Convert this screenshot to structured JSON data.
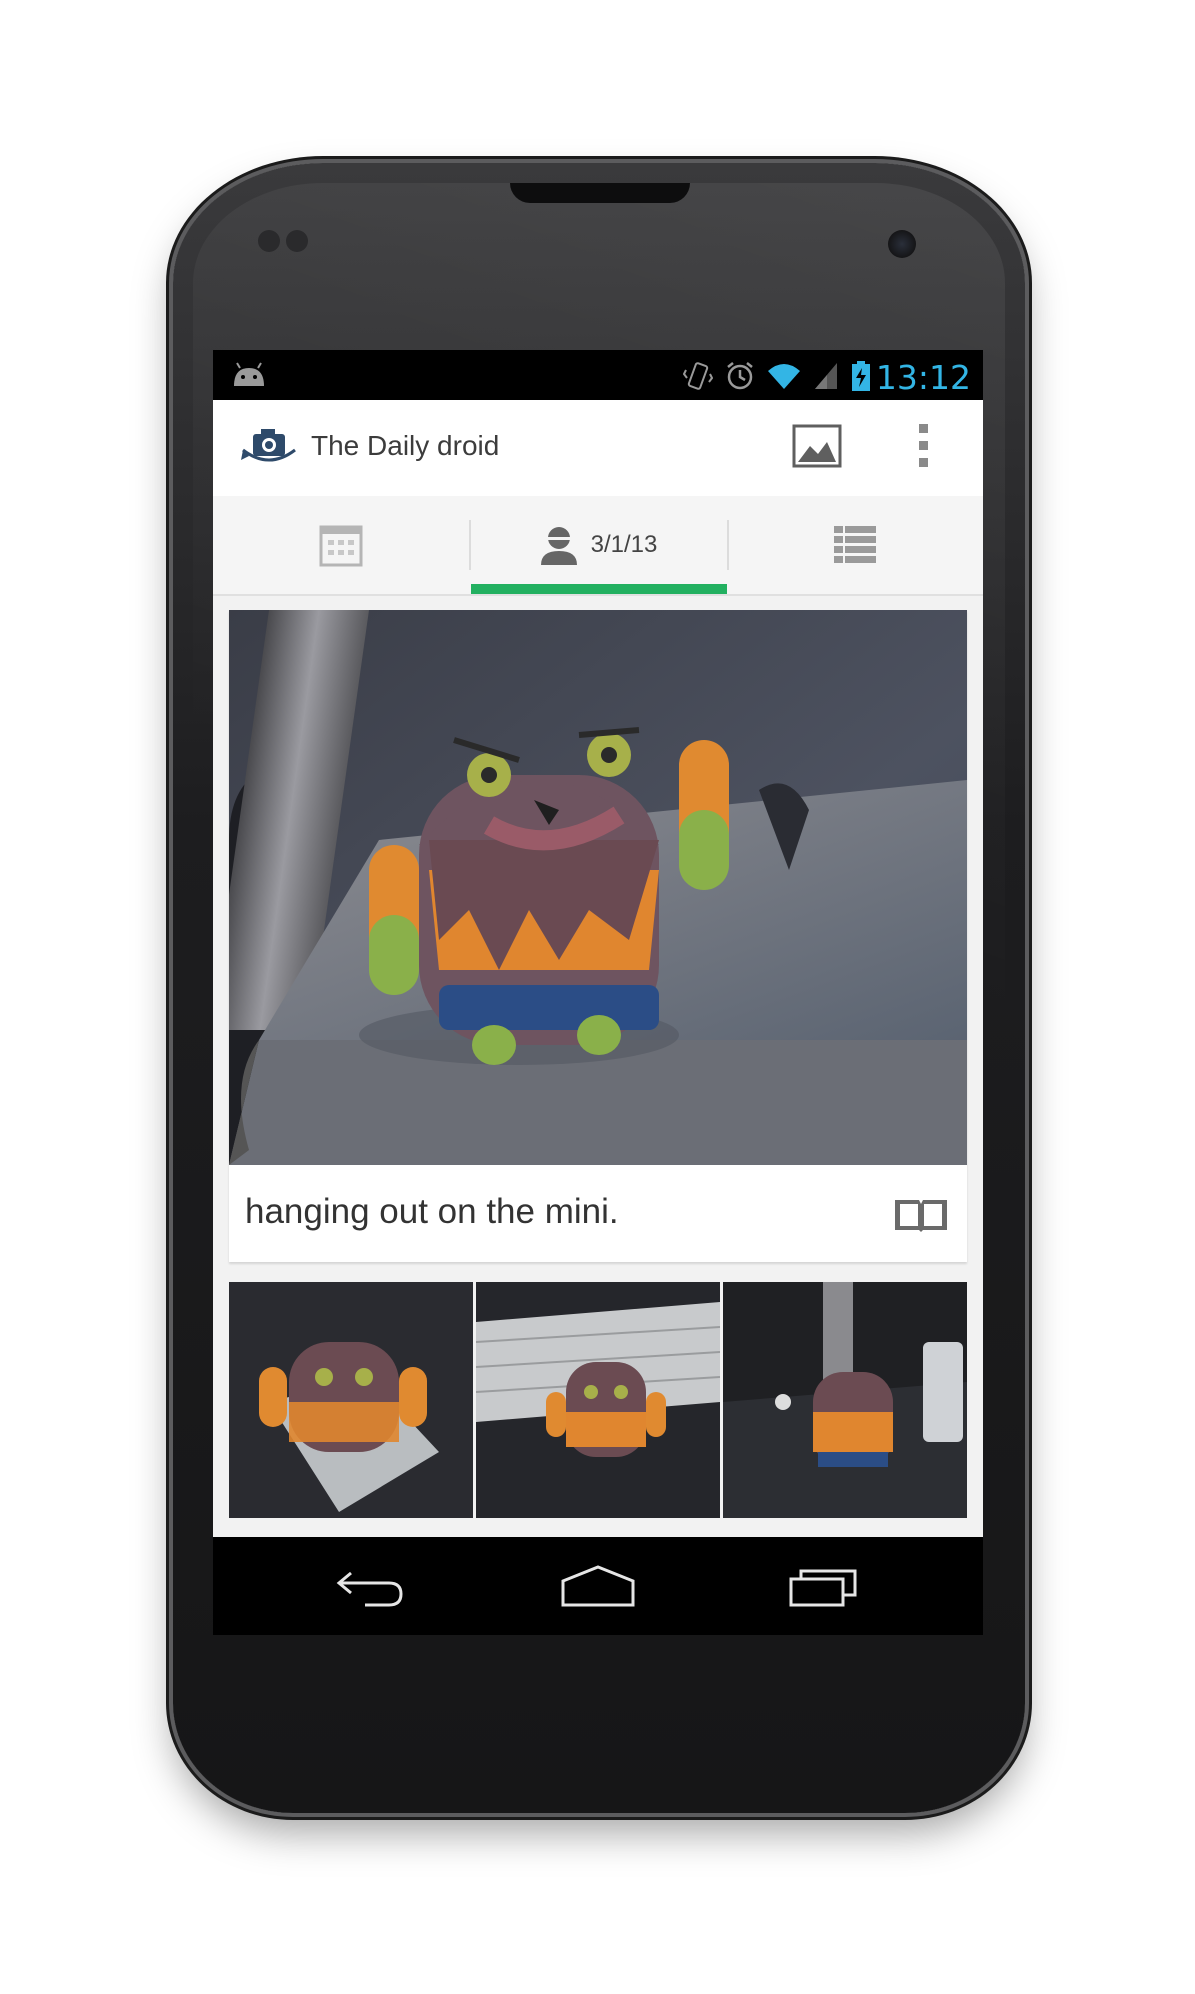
{
  "status_bar": {
    "time": "13:12",
    "icons": [
      "android-icon",
      "vibrate-icon",
      "alarm-icon",
      "wifi-icon",
      "signal-icon",
      "battery-charging-icon"
    ]
  },
  "action_bar": {
    "title": "The Daily droid",
    "app_icon": "camera-rotate-icon",
    "actions": [
      "gallery-icon",
      "overflow-menu-icon"
    ]
  },
  "tabs": [
    {
      "icon": "calendar-icon",
      "label": ""
    },
    {
      "icon": "person-icon",
      "label": "3/1/13",
      "selected": true
    },
    {
      "icon": "list-icon",
      "label": ""
    }
  ],
  "entry": {
    "caption": "hanging out on the mini.",
    "caption_icon": "journal-book-icon"
  },
  "thumbnails": [
    "thumbnail-1",
    "thumbnail-2",
    "thumbnail-3"
  ],
  "nav_bar": {
    "buttons": [
      "back-icon",
      "home-icon",
      "recents-icon"
    ]
  },
  "colors": {
    "accent_blue": "#33b5e5",
    "tab_indicator": "#22b060"
  }
}
